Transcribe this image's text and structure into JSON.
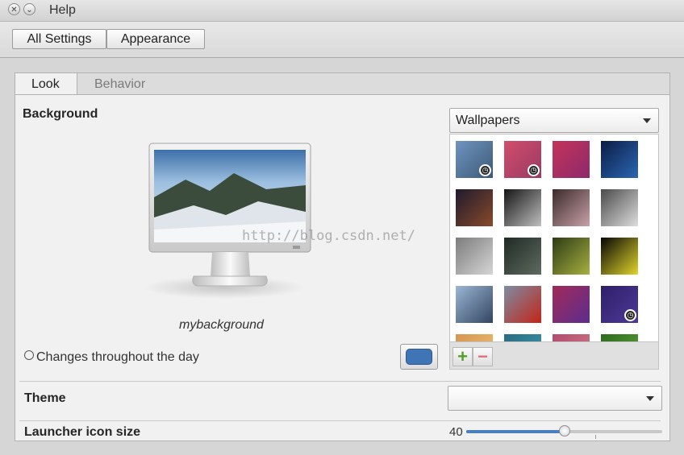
{
  "window": {
    "title": "Help",
    "close_glyph": "✕",
    "menu_glyph": "⌄"
  },
  "toolbar": {
    "all_settings_label": "All Settings",
    "appearance_label": "Appearance"
  },
  "tabs": [
    {
      "label": "Look",
      "active": true
    },
    {
      "label": "Behavior",
      "active": false
    }
  ],
  "background": {
    "heading": "Background",
    "source_combo": "Wallpapers",
    "preview_name": "mybackground",
    "changes_throughout_day_label": "Changes throughout the day",
    "color_swatch": "#3f74b6"
  },
  "gallery": {
    "wallpapers": [
      {
        "icon": "mountains-thumb",
        "colors": [
          "#6f94bf",
          "#3c5a78"
        ],
        "slideshow": true
      },
      {
        "icon": "pink-abstract-thumb",
        "colors": [
          "#d14d6d",
          "#9a3a62"
        ],
        "slideshow": true
      },
      {
        "icon": "magenta-abstract-thumb",
        "colors": [
          "#c43359",
          "#8c2a6c"
        ],
        "slideshow": false
      },
      {
        "icon": "blue-planet-thumb",
        "colors": [
          "#0b1c45",
          "#2b67b3"
        ],
        "slideshow": false
      },
      {
        "icon": "night-sky-thumb",
        "colors": [
          "#1e1a2e",
          "#8a4a2a"
        ],
        "slideshow": false
      },
      {
        "icon": "clock-thumb",
        "colors": [
          "#151515",
          "#bfbfbf"
        ],
        "slideshow": false
      },
      {
        "icon": "beads-thumb",
        "colors": [
          "#3a2a2a",
          "#c9a1a9"
        ],
        "slideshow": false
      },
      {
        "icon": "grass-thumb",
        "colors": [
          "#4a4a4a",
          "#dedede"
        ],
        "slideshow": false
      },
      {
        "icon": "ice-thumb",
        "colors": [
          "#7c7c7c",
          "#d6d6d6"
        ],
        "slideshow": false
      },
      {
        "icon": "dark-texture-thumb",
        "colors": [
          "#1f2a24",
          "#5f6a60"
        ],
        "slideshow": false
      },
      {
        "icon": "bird-thumb",
        "colors": [
          "#2c3b15",
          "#a8b040"
        ],
        "slideshow": false
      },
      {
        "icon": "yellow-flower-thumb",
        "colors": [
          "#050505",
          "#e2d62a"
        ],
        "slideshow": false
      },
      {
        "icon": "misty-lake-thumb",
        "colors": [
          "#9bb6d4",
          "#324560"
        ],
        "slideshow": false
      },
      {
        "icon": "red-flowers-thumb",
        "colors": [
          "#7b8ea3",
          "#c42318"
        ],
        "slideshow": false
      },
      {
        "icon": "violet-gradient-thumb",
        "colors": [
          "#a32a5a",
          "#5b2d8e"
        ],
        "slideshow": false
      },
      {
        "icon": "purple-pattern-thumb",
        "colors": [
          "#2e1f6a",
          "#4d3a96"
        ],
        "slideshow": true
      },
      {
        "icon": "sunset-thumb",
        "colors": [
          "#d59550",
          "#f2c578"
        ],
        "slideshow": false
      },
      {
        "icon": "teal-thumb",
        "colors": [
          "#2a6b80",
          "#3a9fb0"
        ],
        "slideshow": false
      },
      {
        "icon": "rose-thumb",
        "colors": [
          "#b24a6a",
          "#d37f8f"
        ],
        "slideshow": false
      },
      {
        "icon": "green-thumb",
        "colors": [
          "#2c6a1e",
          "#5fa83b"
        ],
        "slideshow": false
      }
    ],
    "add_glyph": "+",
    "remove_glyph": "−"
  },
  "theme": {
    "label": "Theme",
    "value": ""
  },
  "launcher": {
    "label": "Launcher icon size",
    "value": "40",
    "fraction": 0.5
  },
  "watermark": "http://blog.csdn.net/"
}
